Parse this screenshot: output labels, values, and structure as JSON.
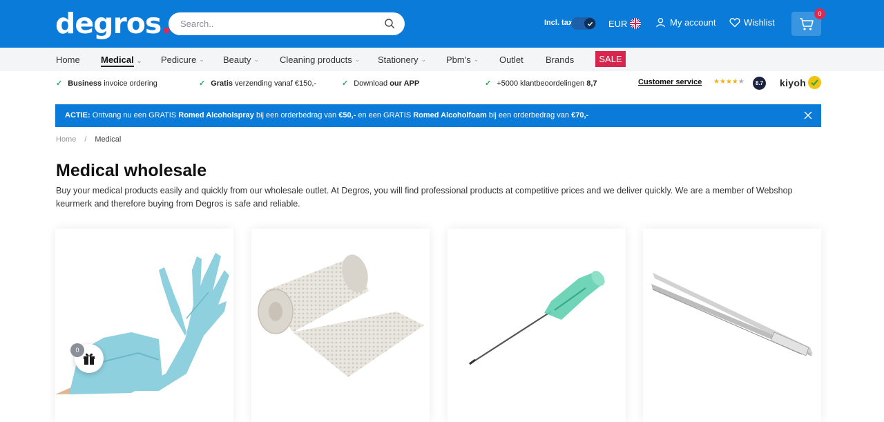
{
  "header": {
    "logo_text": "degros",
    "logo_dot": ".",
    "search_placeholder": "Search..",
    "tax_label": "Incl. tax",
    "currency": "EUR",
    "account_label": "My account",
    "wishlist_label": "Wishlist",
    "cart_count": "0"
  },
  "nav": {
    "items": [
      {
        "label": "Home"
      },
      {
        "label": "Medical"
      },
      {
        "label": "Pedicure"
      },
      {
        "label": "Beauty"
      },
      {
        "label": "Cleaning products"
      },
      {
        "label": "Stationery"
      },
      {
        "label": "Pbm's"
      },
      {
        "label": "Outlet"
      },
      {
        "label": "Brands"
      }
    ],
    "sale_label": "SALE"
  },
  "usps": [
    {
      "bold": "Business",
      "text": " invoice ordering"
    },
    {
      "bold": "Gratis",
      "text": " verzending vanaf €150,-"
    },
    {
      "pre": "Download ",
      "bold": "our APP"
    },
    {
      "pre": "+5000 klantbeoordelingen ",
      "bold": "8,7"
    }
  ],
  "reviews": {
    "customer_service": "Customer service",
    "rating_stars": 4,
    "score": "8.7",
    "brand": "kiyoh"
  },
  "promo": {
    "p1": "ACTIE:",
    "p2": " Ontvang nu een GRATIS ",
    "p3": "Romed Alcoholspray",
    "p4": " bij een orderbedrag van ",
    "p5": "€50,-",
    "p6": " en een GRATIS ",
    "p7": "Romed Alcoholfoam",
    "p8": " bij een orderbedrag van ",
    "p9": "€70,-"
  },
  "breadcrumb": {
    "home": "Home",
    "separator": "/",
    "current": "Medical"
  },
  "page": {
    "title": "Medical wholesale",
    "intro": "Buy your medical products easily and quickly from our wholesale outlet. At Degros, you will find professional products at competitive prices and we deliver quickly. We are a member of Webshop keurmerk and therefore buying from Degros is safe and reliable."
  },
  "products": [
    {
      "image": "blue-nitrile-glove"
    },
    {
      "image": "plaster-bandage-roll"
    },
    {
      "image": "hypodermic-needle"
    },
    {
      "image": "tweezers"
    }
  ],
  "gift": {
    "count": "0"
  },
  "colors": {
    "brand_blue": "#0a7bd8",
    "sale_red": "#d7264e",
    "check_green": "#25a95b"
  }
}
